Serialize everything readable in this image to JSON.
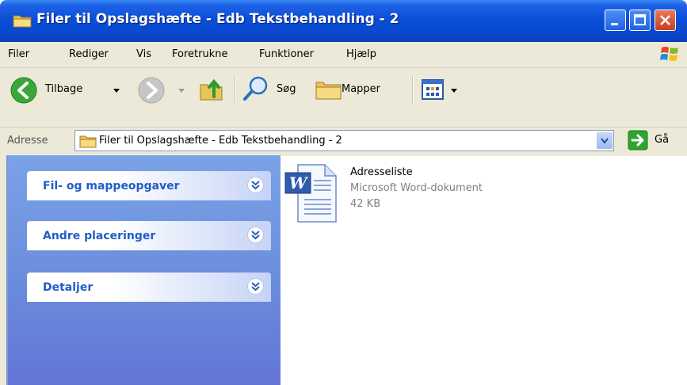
{
  "window": {
    "title": "Filer til Opslagshæfte - Edb Tekstbehandling - 2",
    "colors": {
      "titlebar": "#0a4fd9",
      "chrome": "#ece9d8",
      "task_pane": "#6d91de",
      "task_title": "#215dc6"
    }
  },
  "menu": [
    {
      "label": "Filer",
      "icon": ""
    },
    {
      "label": "Rediger"
    },
    {
      "label": "Vis"
    },
    {
      "label": "Foretrukne"
    },
    {
      "label": "Funktioner"
    },
    {
      "label": "Hjælp"
    }
  ],
  "toolbar": {
    "back_label": "Tilbage",
    "search_label": "Søg",
    "folders_label": "Mapper",
    "icons": [
      "back-arrow-icon",
      "forward-arrow-icon",
      "up-folder-icon",
      "search-icon",
      "folders-icon",
      "views-icon"
    ]
  },
  "address": {
    "label": "Adresse",
    "value": "Filer til Opslagshæfte - Edb Tekstbehandling - 2",
    "go_label": "Gå"
  },
  "tasks": [
    {
      "title": "Fil- og mappeopgaver"
    },
    {
      "title": "Andre placeringer"
    },
    {
      "title": "Detaljer"
    }
  ],
  "files": [
    {
      "name": "Adresseliste",
      "type": "Microsoft Word-dokument",
      "size": "42 KB",
      "icon": "word-document-icon"
    }
  ]
}
